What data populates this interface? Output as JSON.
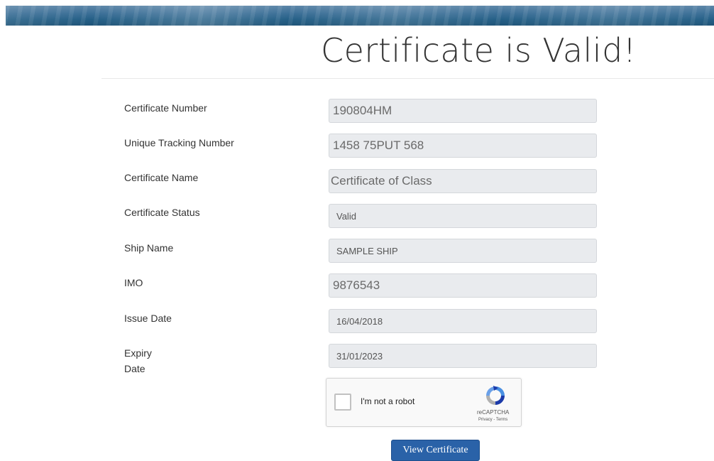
{
  "page": {
    "title": "Certificate is Valid!"
  },
  "fields": [
    {
      "label": "Certificate Number",
      "value": "190804HM"
    },
    {
      "label": "Unique Tracking Number",
      "value": "1458 75PUT 568"
    },
    {
      "label": "Certificate Name",
      "value": "Certificate of Class"
    },
    {
      "label": "Certificate Status",
      "value": "Valid"
    },
    {
      "label": "Ship Name",
      "value": "SAMPLE SHIP"
    },
    {
      "label": "IMO",
      "value": "9876543"
    },
    {
      "label": "Issue Date",
      "value": "16/04/2018"
    },
    {
      "label_line1": "Expiry",
      "label_line2": "Date",
      "value": "31/01/2023"
    }
  ],
  "recaptcha": {
    "label": "I'm not a robot",
    "brand": "reCAPTCHA",
    "links": "Privacy - Terms",
    "checked": false
  },
  "actions": {
    "view_certificate": "View Certificate"
  },
  "colors": {
    "button": "#2a62a8",
    "field_bg": "#e9ebee",
    "banner": "#245f86"
  }
}
